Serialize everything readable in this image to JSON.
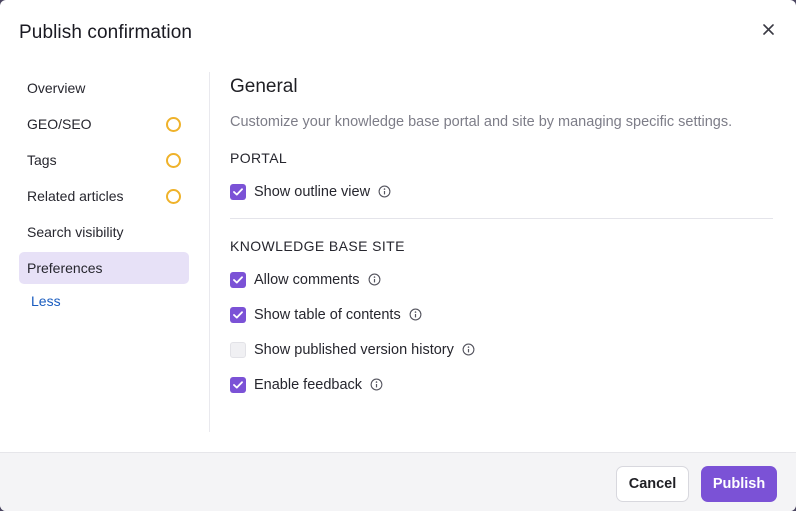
{
  "dialog": {
    "title": "Publish confirmation"
  },
  "sidebar": {
    "items": [
      {
        "label": "Overview",
        "indicator": false,
        "active": false
      },
      {
        "label": "GEO/SEO",
        "indicator": true,
        "active": false
      },
      {
        "label": "Tags",
        "indicator": true,
        "active": false
      },
      {
        "label": "Related articles",
        "indicator": true,
        "active": false
      },
      {
        "label": "Search visibility",
        "indicator": false,
        "active": false
      },
      {
        "label": "Preferences",
        "indicator": false,
        "active": true
      }
    ],
    "less_label": "Less"
  },
  "main": {
    "section_title": "General",
    "description": "Customize your knowledge base portal and site by managing specific settings.",
    "portal": {
      "heading": "PORTAL",
      "options": [
        {
          "label": "Show outline view",
          "checked": true
        }
      ]
    },
    "site": {
      "heading": "KNOWLEDGE BASE SITE",
      "options": [
        {
          "label": "Allow comments",
          "checked": true
        },
        {
          "label": "Show table of contents",
          "checked": true
        },
        {
          "label": "Show published version history",
          "checked": false
        },
        {
          "label": "Enable feedback",
          "checked": true
        }
      ]
    }
  },
  "footer": {
    "cancel_label": "Cancel",
    "publish_label": "Publish"
  },
  "colors": {
    "accent": "#7b52d6",
    "active_nav_bg": "#e7e1f7",
    "indicator_ring": "#efb22a",
    "link": "#1a5cbf"
  },
  "icons": {
    "close": "close-icon",
    "check": "checkmark-icon",
    "info": "info-icon",
    "pending": "pending-ring-icon"
  }
}
